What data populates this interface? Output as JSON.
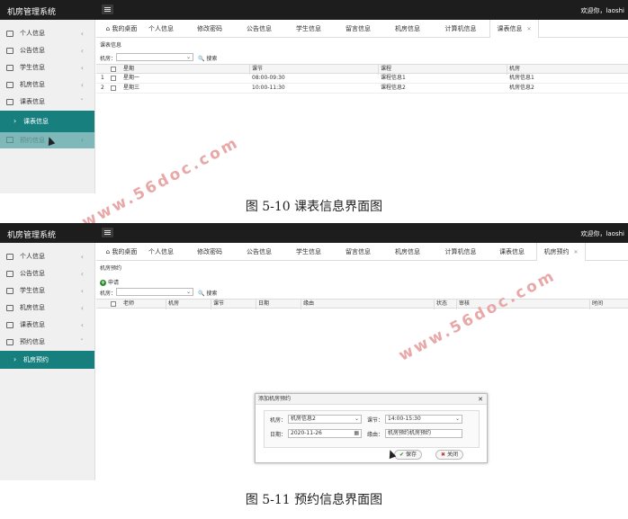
{
  "common": {
    "app_title": "机房管理系统",
    "welcome": "欢迎你，laoshi",
    "filter_label": "机房：",
    "search_label": "搜索",
    "watermark": "www.56doc.com"
  },
  "shot1": {
    "sidebar": [
      {
        "label": "个人信息"
      },
      {
        "label": "公告信息"
      },
      {
        "label": "学生信息"
      },
      {
        "label": "机房信息"
      },
      {
        "label": "课表信息"
      }
    ],
    "sub_active": "课表信息",
    "ghost_item": "预约信息",
    "tabs": [
      "我的桌面",
      "个人信息",
      "修改密码",
      "公告信息",
      "学生信息",
      "留言信息",
      "机房信息",
      "计算机信息",
      "课表信息"
    ],
    "page_title": "课表信息",
    "columns": [
      "星期",
      "课节",
      "课程",
      "机房"
    ],
    "rows": [
      {
        "no": "1",
        "day": "星期一",
        "time": "08:00-09:30",
        "course": "课程信息1",
        "room": "机房信息1"
      },
      {
        "no": "2",
        "day": "星期三",
        "time": "10:00-11:30",
        "course": "课程信息2",
        "room": "机房信息2"
      }
    ],
    "caption": "图 5-10 课表信息界面图"
  },
  "shot2": {
    "sidebar": [
      {
        "label": "个人信息"
      },
      {
        "label": "公告信息"
      },
      {
        "label": "学生信息"
      },
      {
        "label": "机房信息"
      },
      {
        "label": "课表信息"
      },
      {
        "label": "预约信息"
      }
    ],
    "sub_active": "机房预约",
    "tabs": [
      "我的桌面",
      "个人信息",
      "修改密码",
      "公告信息",
      "学生信息",
      "留言信息",
      "机房信息",
      "计算机信息",
      "课表信息",
      "机房预约"
    ],
    "page_title": "机房预约",
    "add_label": "申请",
    "columns": [
      "老师",
      "机房",
      "课节",
      "日期",
      "缘由",
      "状态",
      "审核",
      "时间"
    ],
    "dialog": {
      "title": "添加机房预约",
      "room_label": "机房：",
      "room_value": "机房信息2",
      "time_label": "课节：",
      "time_value": "14:00-15:30",
      "date_label": "日期：",
      "date_value": "2020-11-26",
      "reason_label": "缘由：",
      "reason_value": "机房预约机房预约",
      "save": "保存",
      "close": "关闭"
    },
    "caption": "图 5-11 预约信息界面图"
  }
}
